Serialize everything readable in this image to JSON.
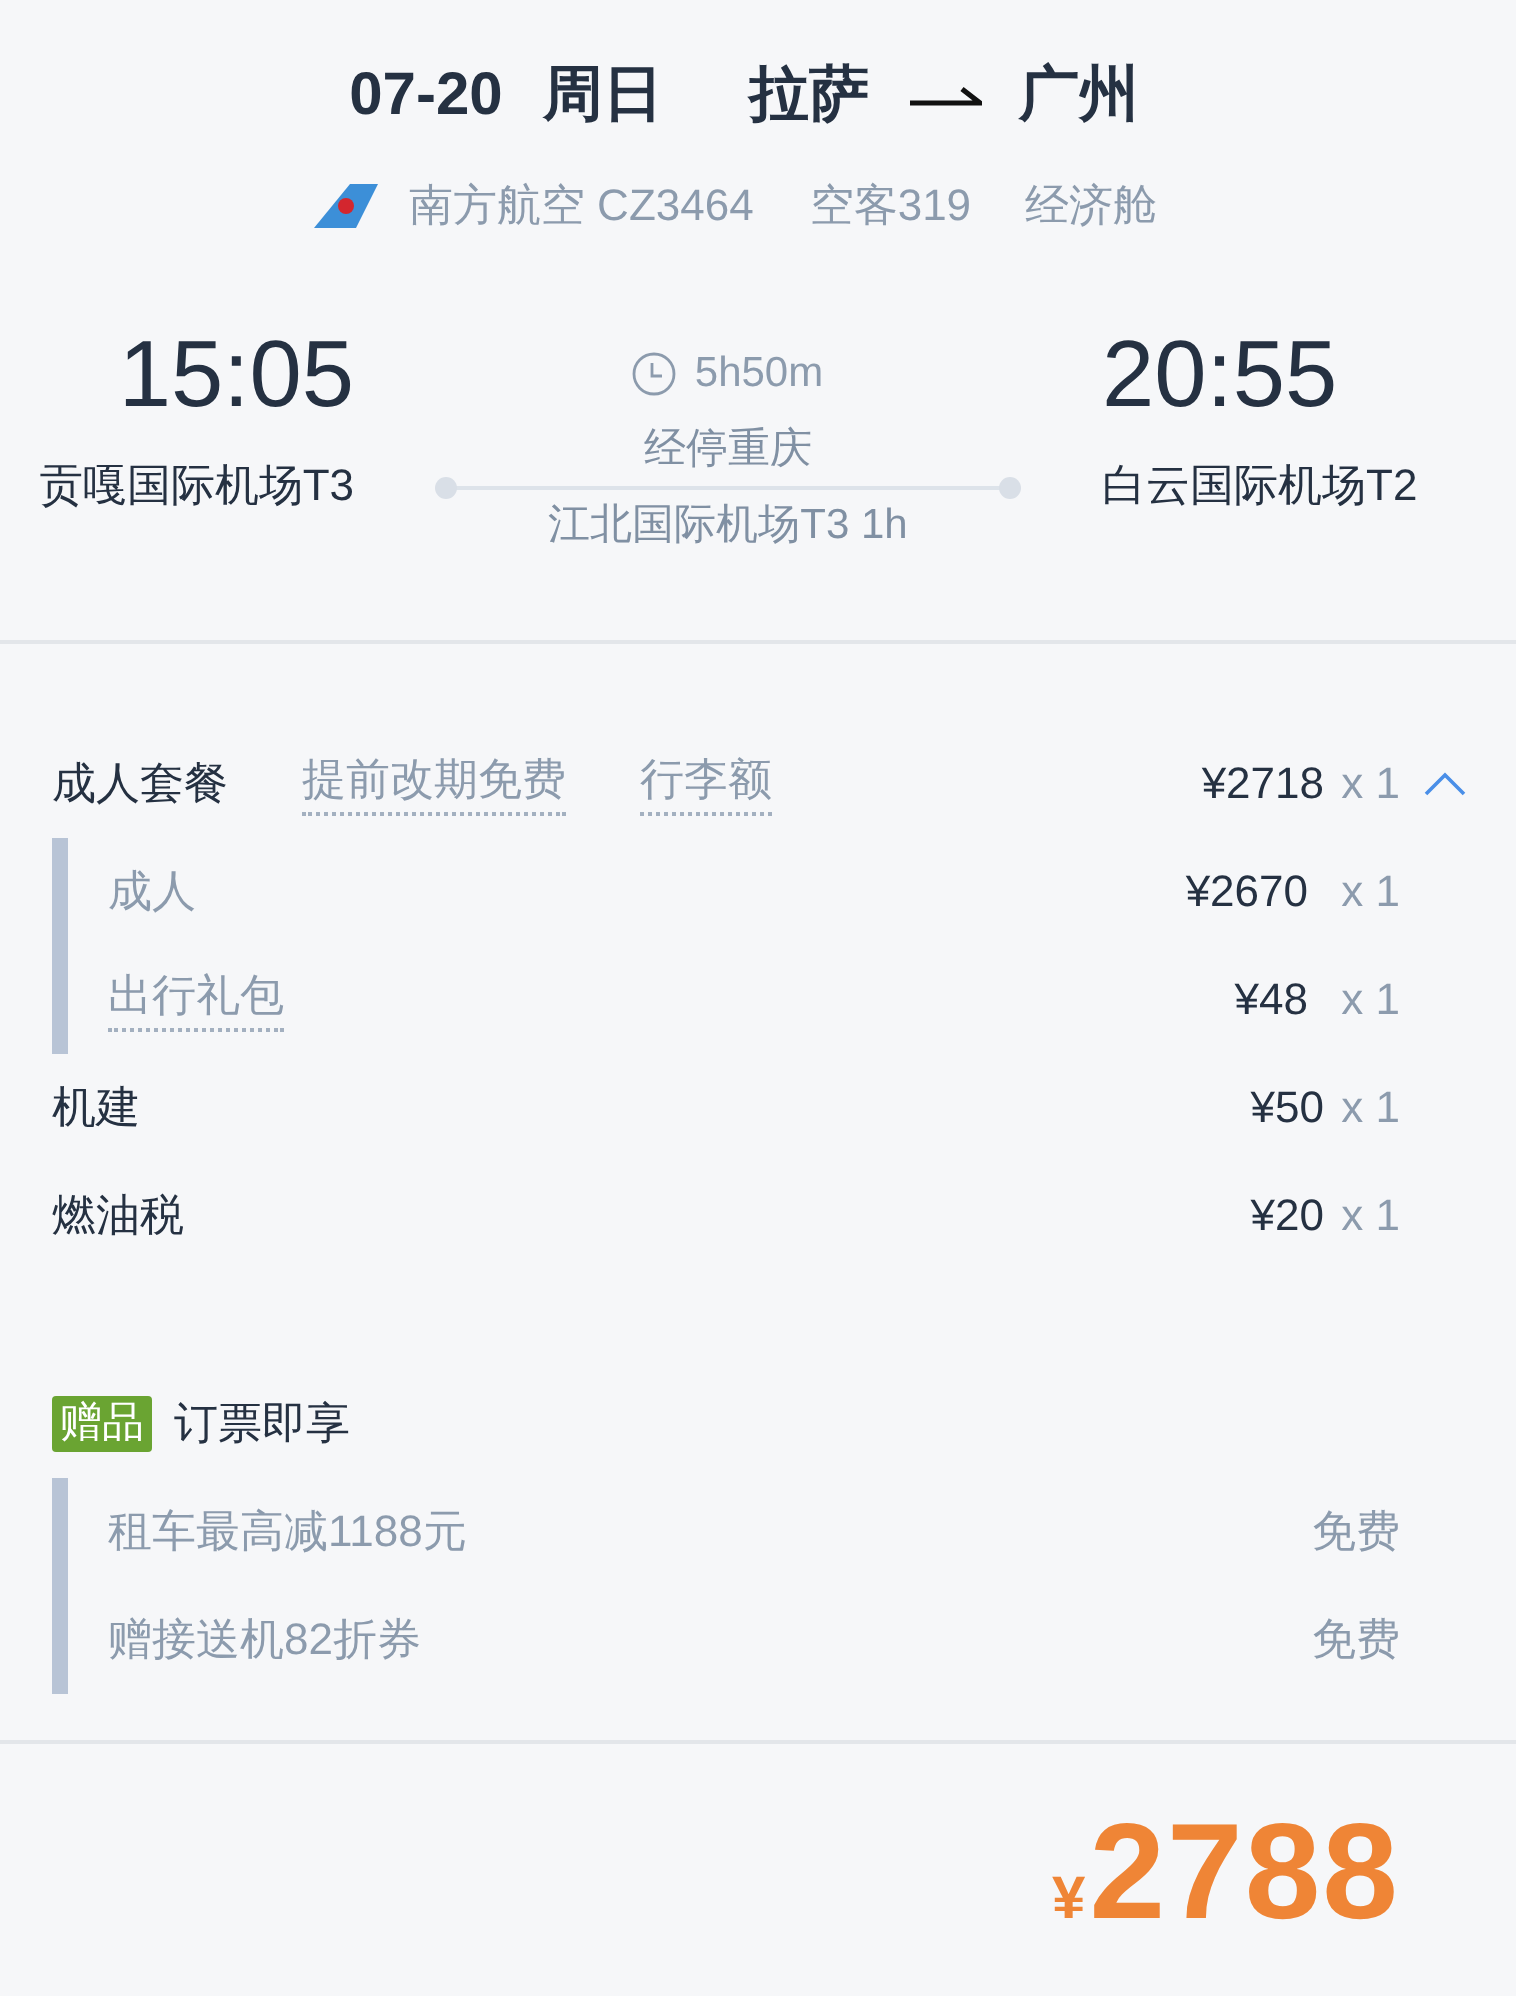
{
  "title": {
    "date": "07-20",
    "weekday": "周日",
    "origin": "拉萨",
    "destination": "广州"
  },
  "flight": {
    "airline": "南方航空 CZ3464",
    "aircraft": "空客319",
    "cabin": "经济舱"
  },
  "itinerary": {
    "departure": {
      "time": "15:05",
      "airport": "贡嘎国际机场T3"
    },
    "duration": "5h50m",
    "stopover": {
      "city": "经停重庆",
      "airport": "江北国际机场T3 1h"
    },
    "arrival": {
      "time": "20:55",
      "airport": "白云国际机场T2"
    }
  },
  "price_items": [
    {
      "kind": "package",
      "label": "成人套餐",
      "links": [
        "提前改期免费",
        "行李额"
      ],
      "price": "¥2718",
      "quantity": "x 1",
      "expanded": true,
      "children": [
        {
          "kind": "text",
          "label": "成人",
          "price": "¥2670",
          "quantity": "x 1"
        },
        {
          "kind": "link",
          "label": "出行礼包",
          "price": "¥48",
          "quantity": "x 1"
        }
      ]
    },
    {
      "kind": "fee",
      "label": "机建",
      "price": "¥50",
      "quantity": "x 1"
    },
    {
      "kind": "fee",
      "label": "燃油税",
      "price": "¥20",
      "quantity": "x 1"
    }
  ],
  "gifts": {
    "badge": "赠品",
    "title": "订票即享",
    "items": [
      {
        "label": "租车最高减1188元",
        "value": "免费"
      },
      {
        "label": "赠接送机82折券",
        "value": "免费"
      }
    ]
  },
  "total": {
    "currency": "¥",
    "amount": "2788"
  }
}
